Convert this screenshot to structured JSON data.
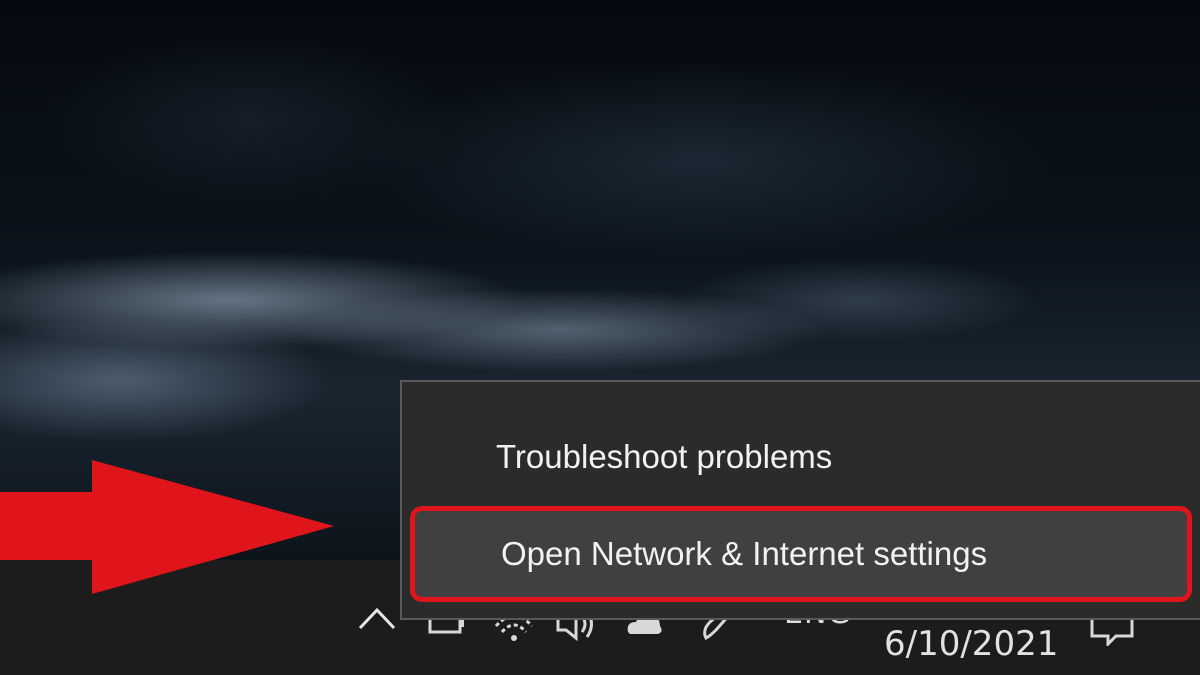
{
  "context_menu": {
    "items": [
      {
        "label": "Troubleshoot problems"
      },
      {
        "label": "Open Network & Internet settings"
      }
    ]
  },
  "taskbar": {
    "tray_icons": [
      "chevron-up-icon",
      "battery-icon",
      "wifi-icon",
      "volume-icon",
      "onedrive-icon",
      "pen-icon"
    ],
    "language": "ENG",
    "date": "6/10/2021",
    "notification_icon": "action-center-icon"
  },
  "colors": {
    "highlight": "#e0141b",
    "menu_bg": "#2b2b2b",
    "menu_hover": "#404040",
    "taskbar_bg": "#1c1c1c"
  }
}
